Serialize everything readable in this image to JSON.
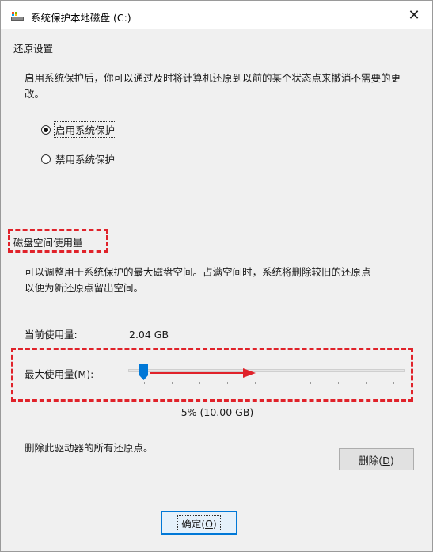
{
  "window": {
    "title": "系统保护本地磁盘 (C:)",
    "close_glyph": "✕"
  },
  "restore_settings": {
    "group_title": "还原设置",
    "description": "启用系统保护后，你可以通过及时将计算机还原到以前的某个状态点来撤消不需要的更改。",
    "options": [
      {
        "label": "启用系统保护",
        "selected": true
      },
      {
        "label": "禁用系统保护",
        "selected": false
      }
    ]
  },
  "disk_usage": {
    "group_title": "磁盘空间使用量",
    "description_line1": "可以调整用于系统保护的最大磁盘空间。占满空间时，系统将删除较旧的还原点",
    "description_line2": "以便为新还原点留出空间。",
    "current_label": "当前使用量:",
    "current_value": "2.04 GB",
    "max_label_prefix": "最大使用量(",
    "max_label_key": "M",
    "max_label_suffix": "):",
    "slider_percent": 5,
    "slider_value_text": "5% (10.00 GB)"
  },
  "delete_section": {
    "description": "删除此驱动器的所有还原点。",
    "button_prefix": "删除(",
    "button_key": "D",
    "button_suffix": ")"
  },
  "footer": {
    "ok_prefix": "确定(",
    "ok_key": "O",
    "ok_suffix": ")"
  },
  "colors": {
    "annotation": "#e0222a",
    "accent": "#0078d7",
    "arrow": "#e0222a"
  }
}
